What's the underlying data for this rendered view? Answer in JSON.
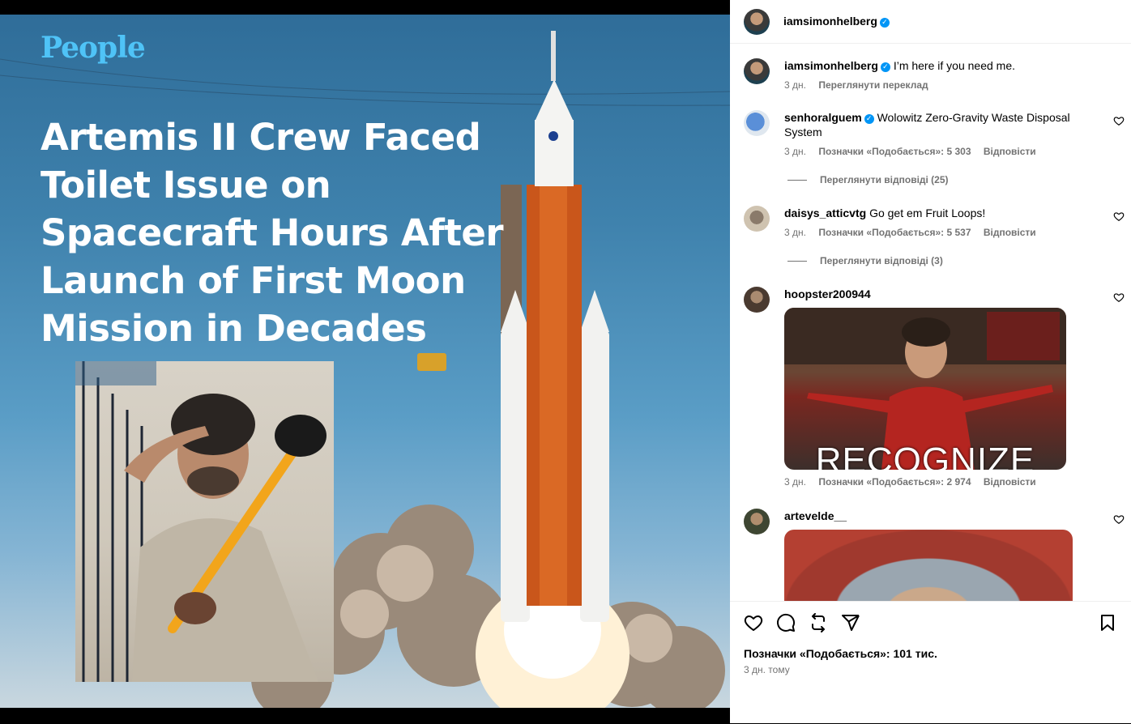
{
  "post": {
    "logo": "People",
    "headline_lines": [
      "Artemis II Crew Faced",
      "Toilet Issue on",
      "Spacecraft Hours After",
      "Launch of First Moon",
      "Mission in Decades"
    ]
  },
  "header": {
    "username": "iamsimonhelberg",
    "verified": true
  },
  "comments": [
    {
      "username": "iamsimonhelberg",
      "verified": true,
      "text": "I’m here if you need me.",
      "time": "3 дн.",
      "action": "Переглянути переклад"
    },
    {
      "username": "senhoralguem",
      "verified": true,
      "text": "Wolowitz Zero-Gravity Waste Disposal System",
      "time": "3 дн.",
      "likes": "Позначки «Подобається»: 5 303",
      "reply": "Відповісти",
      "view_replies": "Переглянути відповіді (25)"
    },
    {
      "username": "daisys_atticvtg",
      "verified": false,
      "text": "Go get em Fruit Loops!",
      "time": "3 дн.",
      "likes": "Позначки «Подобається»: 5 537",
      "reply": "Відповісти",
      "view_replies": "Переглянути відповіді (3)"
    },
    {
      "username": "hoopster200944",
      "verified": false,
      "gif_caption": "RECOGNIZE",
      "time": "3 дн.",
      "likes": "Позначки «Подобається»: 2 974",
      "reply": "Відповісти"
    },
    {
      "username": "artevelde__",
      "verified": false
    }
  ],
  "footer": {
    "likes": "Позначки «Подобається»: 101 тис.",
    "time": "3 дн. тому"
  },
  "icons": {
    "like": "heart-icon",
    "comment": "comment-icon",
    "repost": "repost-icon",
    "share": "share-icon",
    "save": "bookmark-icon",
    "verified": "verified-badge-icon"
  },
  "colors": {
    "verified": "#0095f6",
    "secondary_text": "#737373",
    "logo": "#4fc3f7"
  }
}
